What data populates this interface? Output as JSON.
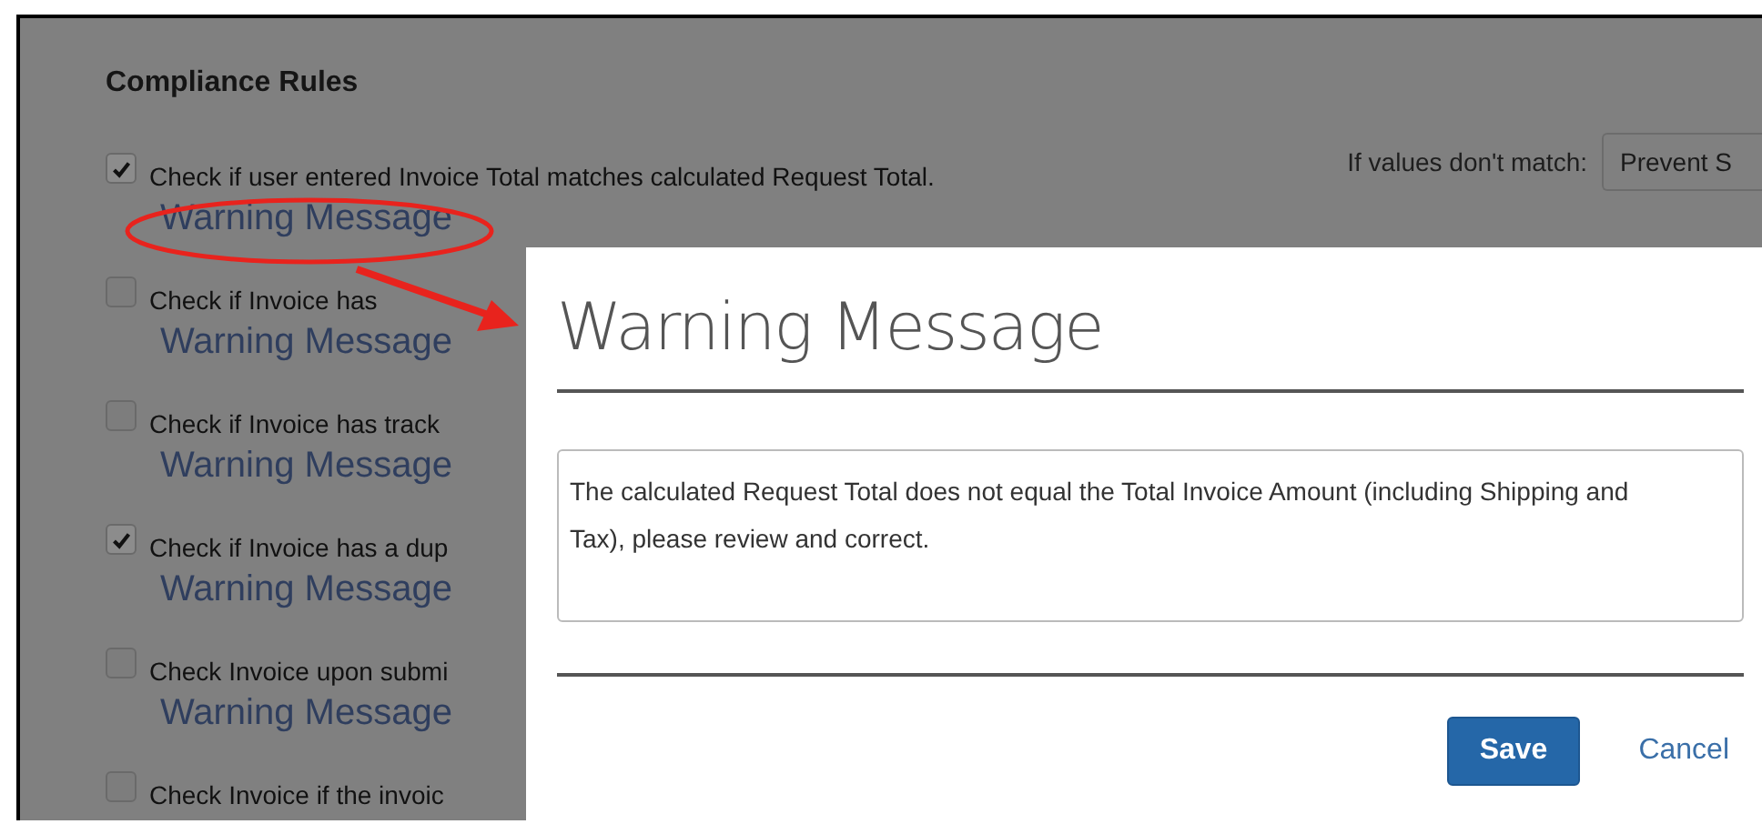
{
  "page": {
    "heading": "Compliance Rules",
    "rules": [
      {
        "label": "Check if user entered Invoice Total matches calculated Request Total.",
        "checked": true,
        "link": "Warning Message"
      },
      {
        "label": "Check if Invoice has",
        "checked": false,
        "link": "Warning Message"
      },
      {
        "label": "Check if Invoice has track",
        "checked": false,
        "link": "Warning Message"
      },
      {
        "label": "Check if Invoice has a dup",
        "checked": true,
        "link": "Warning Message"
      },
      {
        "label": "Check Invoice upon submi",
        "checked": false,
        "link": "Warning Message"
      },
      {
        "label": "Check Invoice if the invoic",
        "checked": false
      }
    ],
    "mismatch": {
      "label": "If values don't match:",
      "value": "Prevent S"
    }
  },
  "dialog": {
    "title": "Warning Message",
    "message": "The calculated Request Total does not equal the Total Invoice Amount (including Shipping and Tax), please review and correct.",
    "buttons": [
      {
        "label": "Save",
        "kind": "primary"
      },
      {
        "label": "Cancel",
        "kind": "link"
      }
    ]
  }
}
